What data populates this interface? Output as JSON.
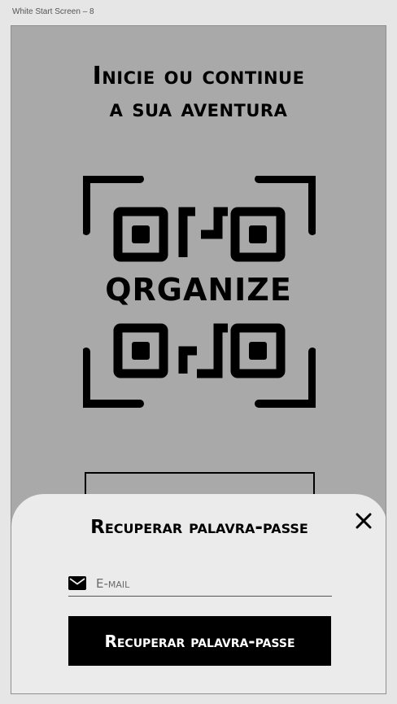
{
  "artboard": {
    "title": "White Start Screen – 8"
  },
  "screen": {
    "headline_line1": "Inicie ou continue",
    "headline_line2": "a sua aventura",
    "logo_text": "QRGANIZE"
  },
  "sheet": {
    "title": "Recuperar palavra-passe",
    "close_icon": "close-icon",
    "email": {
      "icon": "mail-icon",
      "placeholder": "E-mail",
      "value": ""
    },
    "submit_label": "Recuperar palavra-passe"
  },
  "colors": {
    "background": "#e6e6e6",
    "screen_bg": "#a9a9a9",
    "sheet_bg": "#ebebeb",
    "primary": "#000000",
    "on_primary": "#ffffff"
  }
}
